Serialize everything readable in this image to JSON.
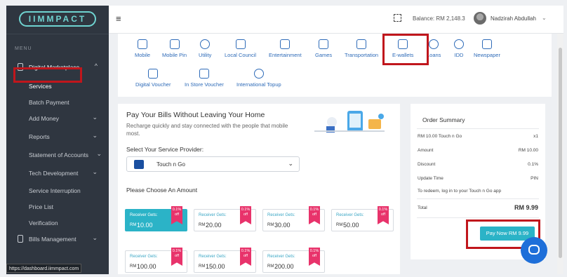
{
  "sidebar": {
    "logo": "IIMMPACT",
    "menu_label": "MENU",
    "items": [
      {
        "label": "Digital Marketplace",
        "chev": "^"
      },
      {
        "label": "Services"
      },
      {
        "label": "Batch Payment"
      },
      {
        "label": "Add Money",
        "chev": "⌄"
      },
      {
        "label": "Reports",
        "chev": "⌄"
      },
      {
        "label": "Statement of Accounts",
        "chev": "⌄"
      },
      {
        "label": "Tech Development",
        "chev": "⌄"
      },
      {
        "label": "Service Interruption"
      },
      {
        "label": "Price List"
      },
      {
        "label": "Verification"
      },
      {
        "label": "Bills Management",
        "chev": "⌄"
      }
    ]
  },
  "status_bar": {
    "url": "https://dashboard.iimmpact.com"
  },
  "topbar": {
    "menu_icon": "≡",
    "balance": "Balance: RM 2,148.3",
    "user": "Nadzirah Abdullah",
    "user_chev": "⌄"
  },
  "categories": {
    "row1": [
      {
        "label": "Mobile",
        "icon": "mobile-icon"
      },
      {
        "label": "Mobile Pin",
        "icon": "mobile-pin-icon"
      },
      {
        "label": "Utility",
        "icon": "utility-icon"
      },
      {
        "label": "Local Council",
        "icon": "council-icon"
      },
      {
        "label": "Entertainment",
        "icon": "entertainment-icon"
      },
      {
        "label": "Games",
        "icon": "games-icon"
      },
      {
        "label": "Transportation",
        "icon": "transport-icon"
      },
      {
        "label": "E-wallets",
        "icon": "wallet-icon"
      },
      {
        "label": "Loans",
        "icon": "loans-icon"
      },
      {
        "label": "IDD",
        "icon": "idd-icon"
      },
      {
        "label": "Newspaper",
        "icon": "newspaper-icon"
      }
    ],
    "row2": [
      {
        "label": "Digital Voucher",
        "icon": "voucher-icon"
      },
      {
        "label": "In Store Voucher",
        "icon": "store-voucher-icon"
      },
      {
        "label": "International Topup",
        "icon": "globe-icon"
      }
    ]
  },
  "main": {
    "title": "Pay Your Bills Without Leaving Your Home",
    "subtitle": "Recharge quickly and stay connected with the people that mobile most.",
    "provider_label": "Select Your Service Provider:",
    "provider_value": "Touch n Go",
    "provider_logo": "Touch n Go",
    "amount_label": "Please Choose An Amount",
    "amounts": [
      {
        "receiver": "Receiver Gets:",
        "currency": "RM",
        "value": "10.00",
        "badge": "0.1% off",
        "selected": true
      },
      {
        "receiver": "Receiver Gets:",
        "currency": "RM",
        "value": "20.00",
        "badge": "0.1% off"
      },
      {
        "receiver": "Receiver Gets:",
        "currency": "RM",
        "value": "30.00",
        "badge": "0.1% off"
      },
      {
        "receiver": "Receiver Gets:",
        "currency": "RM",
        "value": "50.00",
        "badge": "0.1% off"
      },
      {
        "receiver": "Receiver Gets:",
        "currency": "RM",
        "value": "100.00",
        "badge": "0.1% off"
      },
      {
        "receiver": "Receiver Gets:",
        "currency": "RM",
        "value": "150.00",
        "badge": "0.1% off"
      },
      {
        "receiver": "Receiver Gets:",
        "currency": "RM",
        "value": "200.00",
        "badge": "0.1% off"
      }
    ]
  },
  "order_summary": {
    "title": "Order Summary",
    "item": "RM 10.00 Touch n Go",
    "qty": "x1",
    "rows": [
      {
        "label": "Amount",
        "value": "RM 10.00"
      },
      {
        "label": "Discount",
        "value": "0.1%"
      },
      {
        "label": "Update Time",
        "value": "PIN"
      }
    ],
    "note": "To redeem, log in to your Touch n Go app",
    "total_label": "Total",
    "total_value": "RM 9.99",
    "pay_button": "Pay Now RM 9.99"
  },
  "colors": {
    "accent": "#2bb3c7",
    "highlight": "#c0161c",
    "badge": "#e8336b",
    "sidebar": "#2f3640"
  }
}
